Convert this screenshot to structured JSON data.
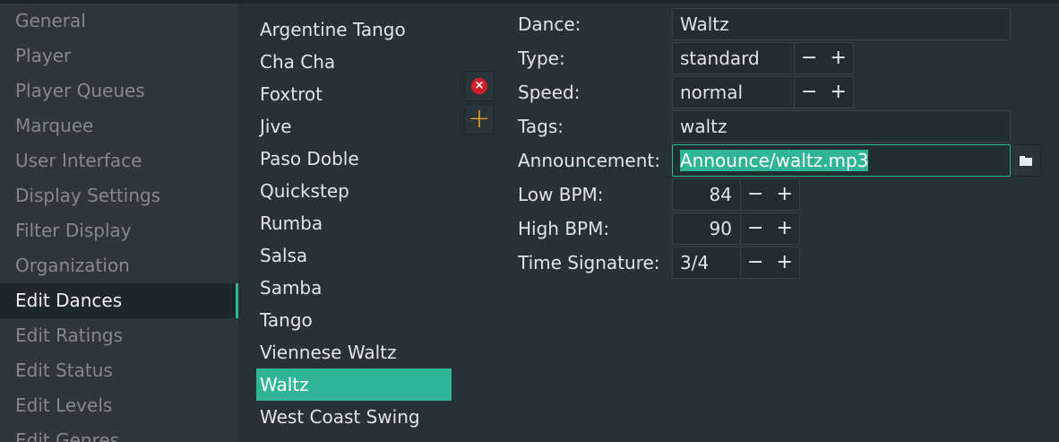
{
  "sidebar": {
    "items": [
      {
        "label": "General"
      },
      {
        "label": "Player"
      },
      {
        "label": "Player Queues"
      },
      {
        "label": "Marquee"
      },
      {
        "label": "User Interface"
      },
      {
        "label": "Display Settings"
      },
      {
        "label": "Filter Display"
      },
      {
        "label": "Organization"
      },
      {
        "label": "Edit Dances"
      },
      {
        "label": "Edit Ratings"
      },
      {
        "label": "Edit Status"
      },
      {
        "label": "Edit Levels"
      },
      {
        "label": "Edit Genres"
      }
    ],
    "active": "Edit Dances"
  },
  "dances": {
    "items": [
      "Argentine Tango",
      "Cha Cha",
      "Foxtrot",
      "Jive",
      "Paso Doble",
      "Quickstep",
      "Rumba",
      "Salsa",
      "Samba",
      "Tango",
      "Viennese Waltz",
      "Waltz",
      "West Coast Swing"
    ],
    "selected": "Waltz",
    "remove_icon": "remove-circle-icon",
    "add_icon": "plus-icon"
  },
  "form": {
    "dance_label": "Dance:",
    "dance_value": "Waltz",
    "type_label": "Type:",
    "type_value": "standard",
    "speed_label": "Speed:",
    "speed_value": "normal",
    "tags_label": "Tags:",
    "tags_value": "waltz",
    "announcement_label": "Announcement:",
    "announcement_value": "Announce/waltz.mp3",
    "low_bpm_label": "Low BPM:",
    "low_bpm_value": "84",
    "high_bpm_label": "High BPM:",
    "high_bpm_value": "90",
    "time_sig_label": "Time Signature:",
    "time_sig_value": "3/4",
    "minus": "−",
    "plus": "+",
    "browse_icon": "folder-icon"
  },
  "colors": {
    "accent": "#30b497",
    "background": "#263238",
    "sidebar": "#2c363b",
    "remove": "#d21f2c",
    "add": "#f5a623"
  }
}
